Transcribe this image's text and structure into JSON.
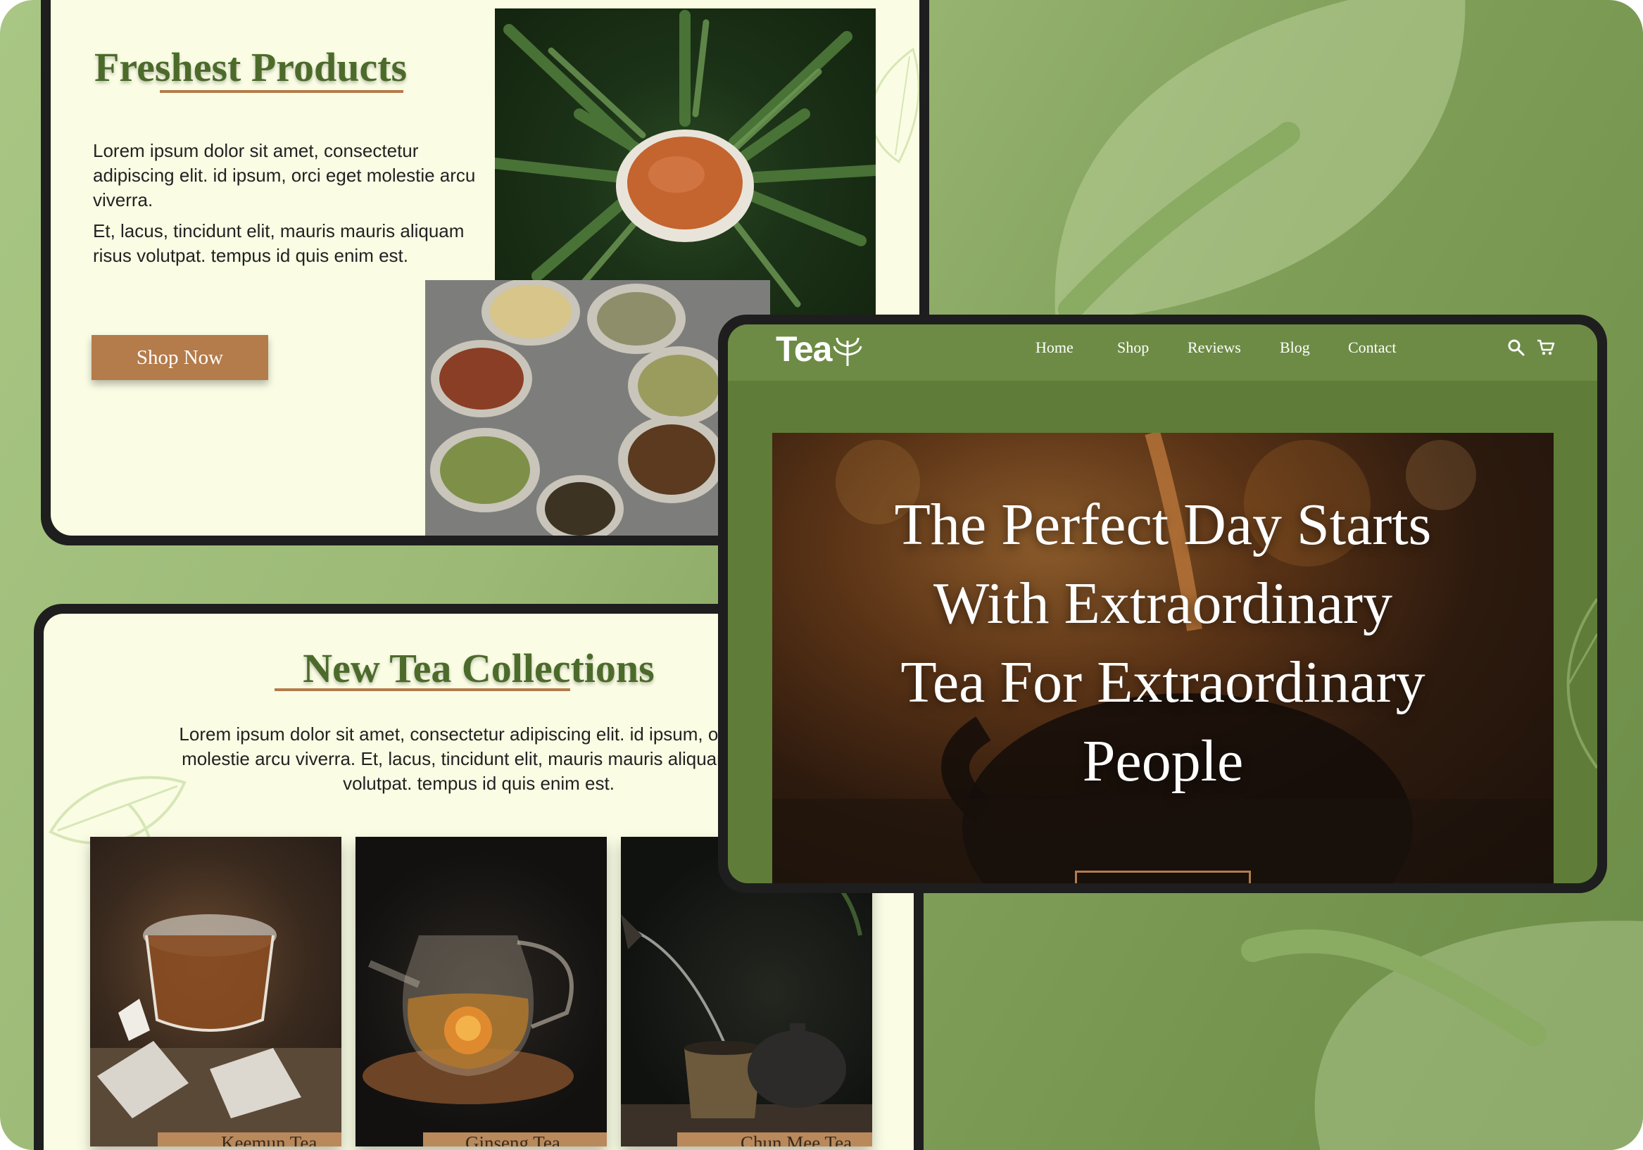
{
  "colors": {
    "background": "#9cba76",
    "cream": "#fafde4",
    "accent_brown": "#b47b4b",
    "heading_green": "#4c6b2b",
    "header_green": "#6d8b45",
    "frame": "#1e1e1e"
  },
  "freshest": {
    "title": "Freshest Products",
    "paragraph1": "Lorem ipsum dolor sit amet, consectetur adipiscing elit. id ipsum, orci eget molestie arcu viverra.",
    "paragraph2": "Et, lacus, tincidunt elit, mauris mauris aliquam risus volutpat. tempus id quis enim est.",
    "button": "Shop Now"
  },
  "website": {
    "logo_text": "Tea",
    "nav": [
      "Home",
      "Shop",
      "Reviews",
      "Blog",
      "Contact"
    ],
    "icons": [
      "search-icon",
      "cart-icon"
    ],
    "hero_lines": [
      "The Perfect Day Starts",
      "With Extraordinary",
      "Tea For Extraordinary",
      "People"
    ]
  },
  "collections": {
    "title": "New Tea Collections",
    "paragraph": "Lorem ipsum dolor sit amet, consectetur adipiscing elit. id ipsum, orci eget molestie arcu viverra. Et, lacus, tincidunt elit, mauris mauris aliquam risus volutpat. tempus id quis enim est.",
    "items": [
      {
        "label": "Keemun Tea"
      },
      {
        "label": "Ginseng Tea"
      },
      {
        "label": "Chun Mee Tea"
      }
    ]
  }
}
